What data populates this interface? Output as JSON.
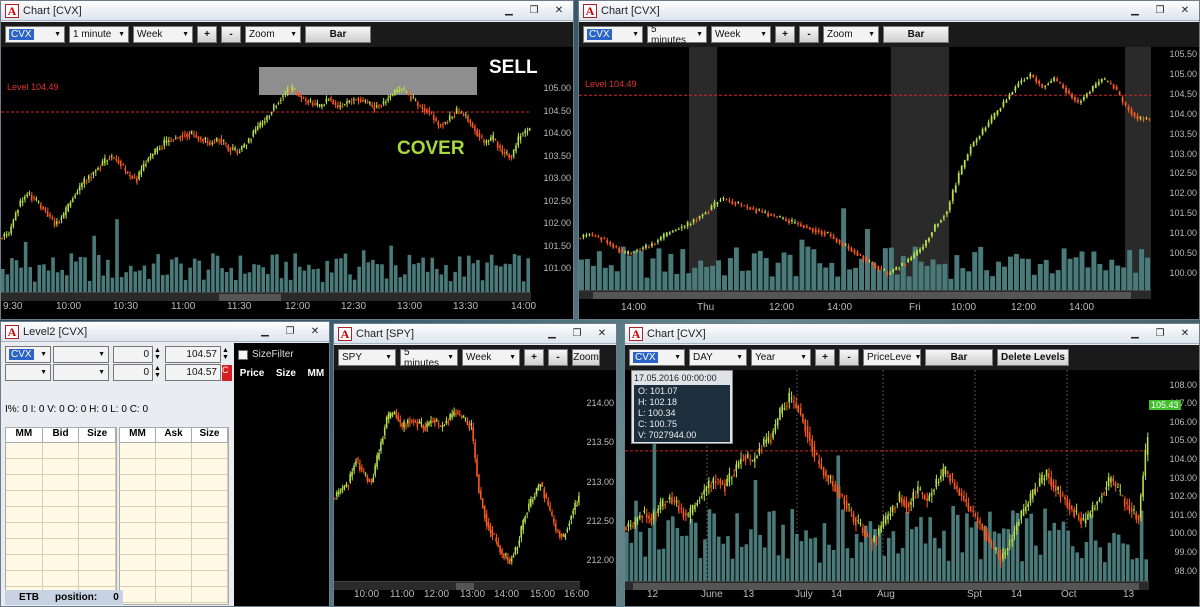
{
  "windows": {
    "chart1": {
      "title": "Chart [CVX]",
      "symbol": "CVX",
      "interval": "1 minute",
      "range": "Week",
      "plus": "+",
      "minus": "-",
      "zoom": "Zoom",
      "type": "Bar",
      "level": "Level 104.49",
      "sell": "SELL",
      "cover": "COVER",
      "yticks": [
        "105.00",
        "104.50",
        "104.00",
        "103.50",
        "103.00",
        "102.50",
        "102.00",
        "101.50",
        "101.00"
      ],
      "xticks": [
        "9:30",
        "10:00",
        "10:30",
        "11:00",
        "11:30",
        "12:00",
        "12:30",
        "13:00",
        "13:30",
        "14:00"
      ],
      "prices": [
        101.8,
        102.4,
        102.7,
        102.5,
        102.3,
        102.0,
        102.2,
        102.6,
        102.9,
        103.1,
        103.3,
        103.5,
        103.4,
        103.1,
        103.0,
        103.4,
        103.6,
        103.8,
        103.9,
        104.0,
        104.0,
        103.9,
        103.8,
        103.9,
        103.7,
        103.6,
        103.8,
        104.1,
        104.3,
        104.6,
        104.9,
        105.0,
        104.8,
        104.7,
        104.6,
        104.8,
        104.6,
        104.7,
        104.8,
        104.7,
        104.6,
        104.7,
        104.9,
        105.0,
        104.8,
        104.6,
        104.5,
        104.2,
        104.3,
        104.5,
        104.4,
        104.1,
        103.8,
        103.9,
        103.6,
        103.5,
        104.0,
        104.1
      ]
    },
    "chart2": {
      "title": "Chart [CVX]",
      "symbol": "CVX",
      "interval": "5 minutes",
      "range": "Week",
      "plus": "+",
      "minus": "-",
      "zoom": "Zoom",
      "type": "Bar",
      "level": "Level 104.49",
      "yticks": [
        "105.50",
        "105.00",
        "104.50",
        "104.00",
        "103.50",
        "103.00",
        "102.50",
        "102.00",
        "101.50",
        "101.00",
        "100.50",
        "100.00"
      ],
      "xticks": [
        "14:00",
        "Thu",
        "12:00",
        "14:00",
        "Fri",
        "10:00",
        "12:00",
        "14:00"
      ],
      "prices": [
        101.0,
        100.9,
        100.7,
        100.5,
        100.6,
        100.7,
        100.9,
        101.1,
        101.2,
        101.4,
        101.6,
        101.9,
        101.8,
        101.7,
        101.6,
        101.5,
        101.4,
        101.3,
        101.2,
        101.1,
        101.0,
        100.8,
        100.6,
        100.4,
        100.2,
        100.0,
        100.2,
        100.4,
        100.7,
        101.2,
        101.6,
        102.5,
        103.2,
        103.6,
        104.0,
        104.4,
        104.8,
        105.0,
        104.7,
        104.9,
        104.6,
        104.3,
        104.6,
        104.9,
        104.7,
        104.2,
        103.9,
        103.9
      ]
    },
    "level2": {
      "title": "Level2 [CVX]",
      "symbol": "CVX",
      "v1": "0",
      "p1": "104.57",
      "v2": "0",
      "p2": "104.57",
      "stats": "I%: 0  I: 0  V: 0  O: 0  H: 0  L: 0  C: 0",
      "bid_cols": [
        "MM",
        "Bid",
        "Size"
      ],
      "ask_cols": [
        "MM",
        "Ask",
        "Size"
      ],
      "sizefilter": "SizeFilter",
      "ts_cols": [
        "Price",
        "Size",
        "MM"
      ],
      "etb": "ETB",
      "position_label": "position:",
      "position": "0"
    },
    "chart3": {
      "title": "Chart [SPY]",
      "symbol": "SPY",
      "interval": "5 minutes",
      "range": "Week",
      "plus": "+",
      "minus": "-",
      "zoom": "Zoom",
      "yticks": [
        "214.00",
        "213.50",
        "213.00",
        "212.50",
        "212.00"
      ],
      "xticks": [
        "10:00",
        "11:00",
        "12:00",
        "13:00",
        "14:00",
        "15:00",
        "16:00"
      ],
      "prices": [
        212.9,
        213.0,
        213.3,
        213.1,
        213.0,
        213.4,
        213.8,
        213.9,
        213.7,
        213.8,
        213.75,
        213.7,
        213.8,
        213.7,
        213.8,
        213.9,
        213.8,
        213.7,
        212.9,
        212.5,
        212.3,
        212.1,
        212.0,
        212.2,
        212.6,
        212.8,
        213.0,
        212.7,
        212.4,
        212.3,
        212.6,
        212.8
      ]
    },
    "chart4": {
      "title": "Chart [CVX]",
      "symbol": "CVX",
      "interval": "DAY",
      "range": "Year",
      "plus": "+",
      "minus": "-",
      "pricelevel": "PriceLeve",
      "type": "Bar",
      "delete": "Delete Levels",
      "tip": {
        "date": "17.05.2016 00:00:00",
        "o": "O: 101.07",
        "h": "H: 102.18",
        "l": "L: 100.34",
        "c": "C: 100.75",
        "v": "V: 7027944.00"
      },
      "last": "105.43",
      "yticks": [
        "108.00",
        "107.00",
        "106.00",
        "105.00",
        "104.00",
        "103.00",
        "102.00",
        "101.00",
        "100.00",
        "99.00",
        "98.00"
      ],
      "xticks": [
        "12",
        "June",
        "13",
        "July",
        "14",
        "Aug",
        "Spt",
        "14",
        "Oct",
        "13"
      ],
      "prices": [
        100.5,
        101.2,
        100.8,
        101.5,
        102.0,
        101.4,
        100.9,
        101.8,
        102.5,
        103.0,
        102.6,
        103.4,
        104.2,
        103.9,
        104.8,
        105.2,
        106.5,
        107.3,
        106.8,
        105.5,
        104.0,
        103.2,
        102.5,
        101.8,
        100.9,
        100.2,
        99.6,
        100.4,
        101.2,
        102.0,
        101.6,
        102.4,
        101.8,
        102.8,
        103.4,
        102.6,
        101.9,
        101.1,
        100.4,
        99.3,
        98.7,
        99.6,
        100.8,
        101.7,
        102.6,
        103.3,
        102.4,
        101.9,
        101.2,
        100.6,
        101.4,
        102.2,
        103.0,
        102.1,
        101.4,
        100.9,
        105.4
      ]
    }
  },
  "colors": {
    "up": "#b8e04a",
    "down": "#ff5a1e",
    "vol": "#4a7a7a",
    "level": "#d02828",
    "accent": "#2b63c7"
  }
}
